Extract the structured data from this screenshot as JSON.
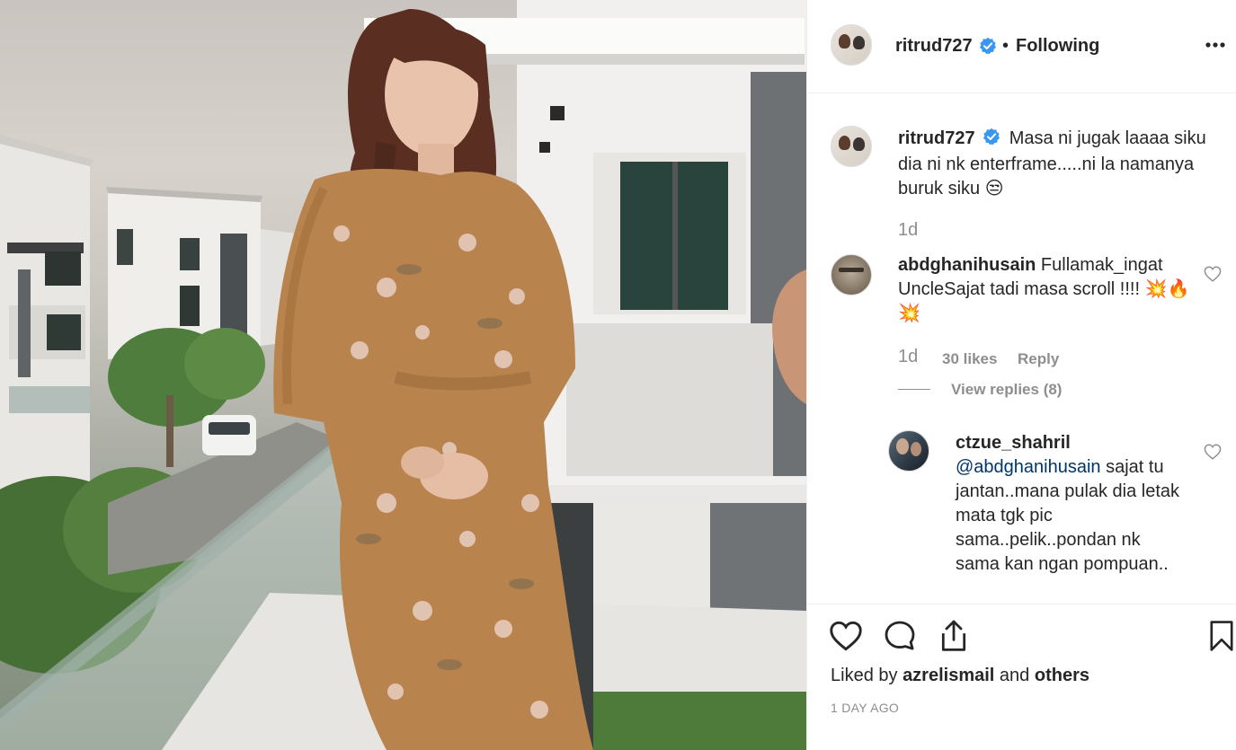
{
  "post": {
    "owner_username": "ritrud727",
    "header_separator": "•",
    "follow_status": "Following",
    "more_icon": "more-horizontal-icon"
  },
  "caption": {
    "username": "ritrud727",
    "text": "Masa ni jugak laaaa siku dia ni nk enterframe.....ni la namanya buruk siku 😒",
    "time": "1d"
  },
  "comments": [
    {
      "username": "abdghanihusain",
      "text": "Fullamak_ingat UncleSajat tadi masa scroll !!!! 💥🔥💥",
      "time": "1d",
      "likes": "30 likes",
      "reply_label": "Reply",
      "view_replies": "View replies (8)"
    },
    {
      "username": "ctzue_shahril",
      "mention": "@abdghanihusain",
      "text": " sajat tu jantan..mana pulak dia letak mata tgk pic sama..pelik..pondan nk sama kan ngan pompuan.."
    }
  ],
  "footer": {
    "liked_by_prefix": "Liked by",
    "liked_by_user": "azrelismail",
    "liked_by_and": "and",
    "liked_by_others": "others",
    "timestamp": "1 DAY AGO"
  },
  "colors": {
    "link_blue": "#003569",
    "verified_blue": "#3897f0",
    "muted": "#8e8e8e",
    "text": "#262626"
  }
}
